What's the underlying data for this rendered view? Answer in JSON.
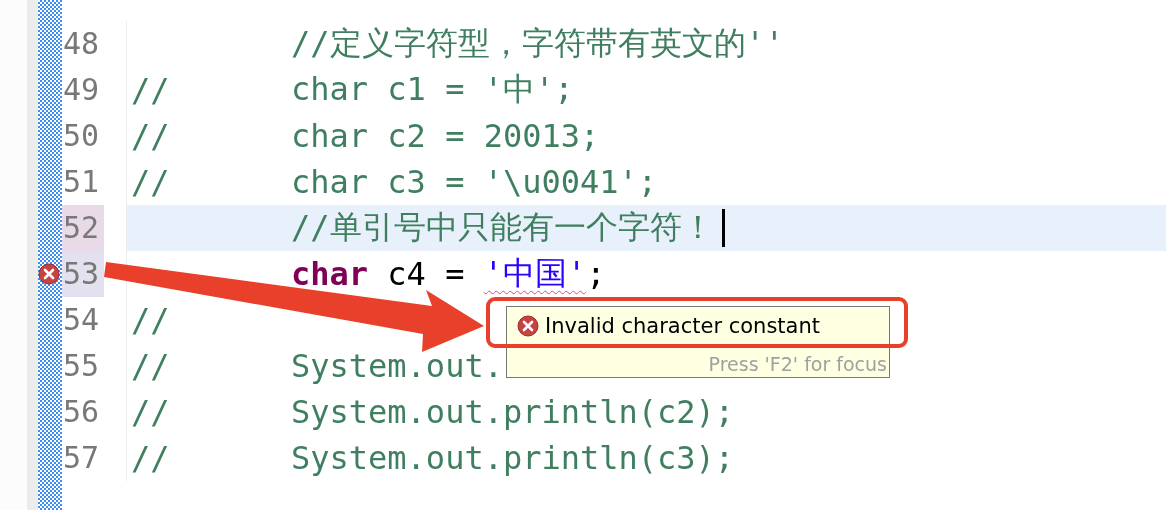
{
  "lines": [
    {
      "number": "48",
      "current": false,
      "error": false,
      "caret": false,
      "segments": [
        {
          "kind": "comment",
          "text": "//定义字符型，字符带有英文的''"
        }
      ]
    },
    {
      "number": "49",
      "current": false,
      "error": false,
      "caret": false,
      "prefix": "//",
      "segments": [
        {
          "kind": "comment",
          "text": "char c1 = '中';"
        }
      ]
    },
    {
      "number": "50",
      "current": false,
      "error": false,
      "caret": false,
      "prefix": "//",
      "segments": [
        {
          "kind": "comment",
          "text": "char c2 = 20013;"
        }
      ]
    },
    {
      "number": "51",
      "current": false,
      "error": false,
      "caret": false,
      "prefix": "//",
      "segments": [
        {
          "kind": "comment",
          "text": "char c3 = '\\u0041';"
        }
      ]
    },
    {
      "number": "52",
      "current": true,
      "error": false,
      "caret": true,
      "segments": [
        {
          "kind": "comment",
          "text": "//单引号中只能有一个字符！"
        }
      ]
    },
    {
      "number": "53",
      "current": false,
      "error": true,
      "caret": false,
      "segments": [
        {
          "kind": "keyword",
          "text": "char"
        },
        {
          "kind": "plain",
          "text": " c4 = "
        },
        {
          "kind": "string",
          "text": "'中国'",
          "flagged": true
        },
        {
          "kind": "plain",
          "text": ";"
        }
      ]
    },
    {
      "number": "54",
      "current": false,
      "error": false,
      "caret": false,
      "prefix": "//"
    },
    {
      "number": "55",
      "current": false,
      "error": false,
      "caret": false,
      "prefix": "//",
      "segments": [
        {
          "kind": "comment",
          "text": "System.out."
        }
      ]
    },
    {
      "number": "56",
      "current": false,
      "error": false,
      "caret": false,
      "prefix": "//",
      "segments": [
        {
          "kind": "comment",
          "text": "System.out.println(c2);"
        }
      ]
    },
    {
      "number": "57",
      "current": false,
      "error": false,
      "caret": false,
      "prefix": "//",
      "segments": [
        {
          "kind": "comment",
          "text": "System.out.println(c3);"
        }
      ]
    }
  ],
  "tooltip": {
    "message": "Invalid character constant",
    "hint": "Press 'F2' for focus"
  }
}
